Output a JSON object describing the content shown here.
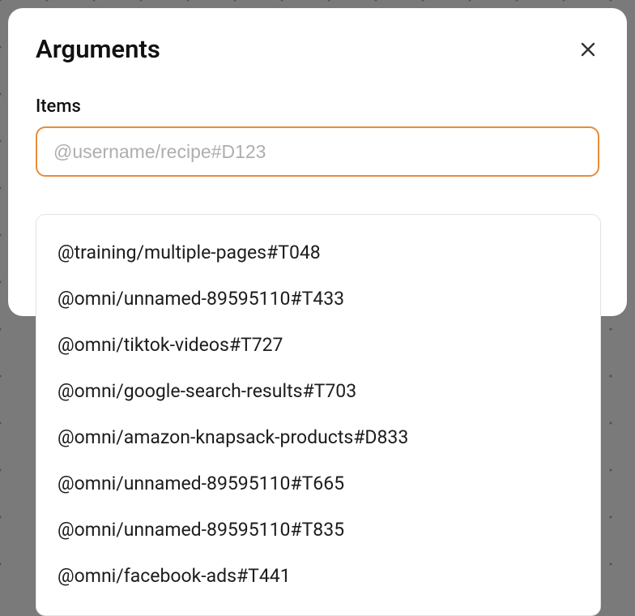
{
  "modal": {
    "title": "Arguments",
    "field_label": "Items",
    "input_placeholder": "@username/recipe#D123",
    "input_value": ""
  },
  "suggestions": [
    "@training/multiple-pages#T048",
    "@omni/unnamed-89595110#T433",
    "@omni/tiktok-videos#T727",
    "@omni/google-search-results#T703",
    "@omni/amazon-knapsack-products#D833",
    "@omni/unnamed-89595110#T665",
    "@omni/unnamed-89595110#T835",
    "@omni/facebook-ads#T441"
  ]
}
